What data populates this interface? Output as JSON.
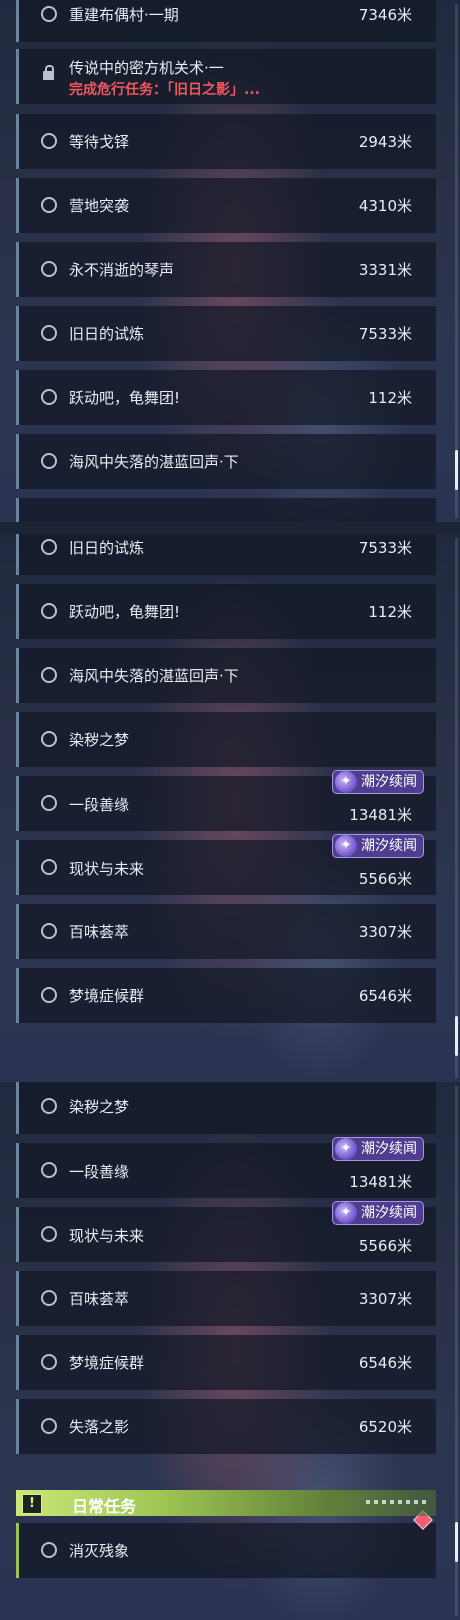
{
  "panel1": {
    "rows": [
      {
        "name": "重建布偶村·一期",
        "dist": "7346米"
      },
      {
        "name": "传说中的密方机关术·一",
        "sub": "完成危行任务：「旧日之影」..."
      },
      {
        "name": "等待戈铎",
        "dist": "2943米"
      },
      {
        "name": "营地突袭",
        "dist": "4310米"
      },
      {
        "name": "永不消逝的琴声",
        "dist": "3331米"
      },
      {
        "name": "旧日的试炼",
        "dist": "7533米"
      },
      {
        "name": "跃动吧，龟舞团!",
        "dist": "112米"
      },
      {
        "name": "海风中失落的湛蓝回声·下",
        "dist": ""
      }
    ]
  },
  "panel2": {
    "rows": [
      {
        "name": "旧日的试炼",
        "dist": "7533米"
      },
      {
        "name": "跃动吧，龟舞团!",
        "dist": "112米"
      },
      {
        "name": "海风中失落的湛蓝回声·下",
        "dist": ""
      },
      {
        "name": "染秽之梦",
        "dist": ""
      },
      {
        "name": "一段善缘",
        "dist": "13481米",
        "badge": "潮汐续闻"
      },
      {
        "name": "现状与未来",
        "dist": "5566米",
        "badge": "潮汐续闻"
      },
      {
        "name": "百味荟萃",
        "dist": "3307米"
      },
      {
        "name": "梦境症候群",
        "dist": "6546米"
      }
    ]
  },
  "panel3": {
    "rows": [
      {
        "name": "染秽之梦",
        "dist": ""
      },
      {
        "name": "一段善缘",
        "dist": "13481米",
        "badge": "潮汐续闻"
      },
      {
        "name": "现状与未来",
        "dist": "5566米",
        "badge": "潮汐续闻"
      },
      {
        "name": "百味荟萃",
        "dist": "3307米"
      },
      {
        "name": "梦境症候群",
        "dist": "6546米"
      },
      {
        "name": "失落之影",
        "dist": "6520米"
      }
    ],
    "daily_header": "日常任务",
    "daily_row": {
      "name": "消灭残象",
      "dist": ""
    }
  },
  "colors": {
    "accent_green": "#9ec552",
    "warning_red": "#f2575d",
    "badge_purple": "#4f3d8f"
  }
}
